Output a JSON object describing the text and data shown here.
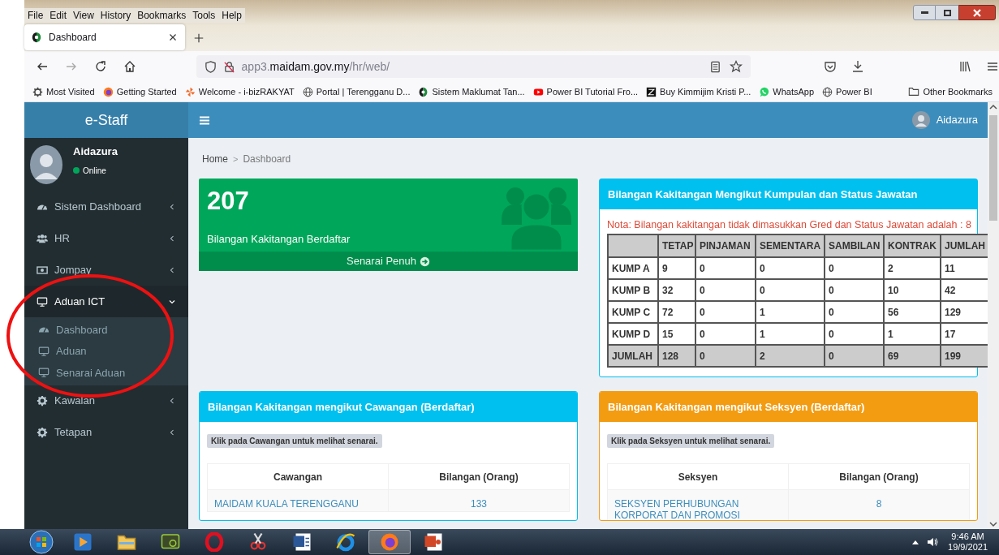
{
  "menu_bar": [
    "File",
    "Edit",
    "View",
    "History",
    "Bookmarks",
    "Tools",
    "Help"
  ],
  "tabs": [
    {
      "title": "Dashboard",
      "selected": true
    }
  ],
  "address_bar": {
    "prefix": "app3.",
    "domain": "maidam.gov.my",
    "path": "/hr/web/"
  },
  "bookmarks": [
    {
      "label": "Most Visited",
      "kind": "gear"
    },
    {
      "label": "Getting Started",
      "kind": "firefox"
    },
    {
      "label": "Welcome - i-bizRAKYAT",
      "kind": "pinwheel"
    },
    {
      "label": "Portal | Terengganu D...",
      "kind": "globe"
    },
    {
      "label": "Sistem Maklumat Tan...",
      "kind": "crest"
    },
    {
      "label": "Power BI Tutorial Fro...",
      "kind": "play"
    },
    {
      "label": "Buy Kimmijim Kristi P...",
      "kind": "square"
    },
    {
      "label": "WhatsApp",
      "kind": "chat"
    },
    {
      "label": "Power BI",
      "kind": "globe"
    }
  ],
  "other_bookmarks": "Other Bookmarks",
  "app": {
    "brand": "e-Staff",
    "top_user": "Aidazura",
    "user": {
      "name": "Aidazura",
      "status": "Online"
    },
    "sidebar": [
      {
        "label": "Sistem Dashboard",
        "kind": "dashboard",
        "expanded": false
      },
      {
        "label": "HR",
        "kind": "users",
        "expanded": false
      },
      {
        "label": "Jompay",
        "kind": "money",
        "expanded": false
      },
      {
        "label": "Aduan ICT",
        "kind": "monitor",
        "expanded": true,
        "children": [
          {
            "label": "Dashboard",
            "kind": "dashboard"
          },
          {
            "label": "Aduan",
            "kind": "monitor"
          },
          {
            "label": "Senarai Aduan",
            "kind": "monitor"
          }
        ]
      },
      {
        "label": "Kawalan",
        "kind": "gear",
        "expanded": false
      },
      {
        "label": "Tetapan",
        "kind": "gear",
        "expanded": false
      }
    ],
    "breadcrumb": {
      "items": [
        "Home",
        "Dashboard"
      ],
      "separator": ">"
    },
    "stat_card": {
      "value": "207",
      "label": "Bilangan Kakitangan Berdaftar",
      "link": "Senarai Penuh"
    },
    "status_panel": {
      "title": "Bilangan Kakitangan Mengikut Kumpulan dan Status Jawatan",
      "note": "Nota: Bilangan kakitangan tidak dimasukkan Gred dan Status Jawatan adalah : 8",
      "columns": [
        "TETAP",
        "PINJAMAN",
        "SEMENTARA",
        "SAMBILAN",
        "KONTRAK",
        "JUMLAH"
      ],
      "rows": [
        {
          "label": "KUMP A",
          "kind": "group",
          "values": [
            "9",
            "0",
            "0",
            "0",
            "2",
            "11"
          ]
        },
        {
          "label": "KUMP B",
          "kind": "group",
          "values": [
            "32",
            "0",
            "0",
            "0",
            "10",
            "42"
          ]
        },
        {
          "label": "KUMP C",
          "kind": "group",
          "values": [
            "72",
            "0",
            "1",
            "0",
            "56",
            "129"
          ]
        },
        {
          "label": "KUMP D",
          "kind": "group",
          "values": [
            "15",
            "0",
            "1",
            "0",
            "1",
            "17"
          ]
        },
        {
          "label": "JUMLAH",
          "kind": "total",
          "values": [
            "128",
            "0",
            "2",
            "0",
            "69",
            "199"
          ]
        }
      ]
    },
    "branch_panel": {
      "title": "Bilangan Kakitangan mengikut Cawangan (Berdaftar)",
      "hint": "Klik pada Cawangan untuk melihat senarai.",
      "columns": [
        "Cawangan",
        "Bilangan (Orang)"
      ],
      "rows": [
        [
          "MAIDAM KUALA TERENGGANU",
          "133"
        ]
      ]
    },
    "section_panel": {
      "title": "Bilangan Kakitangan mengikut Seksyen (Berdaftar)",
      "hint": "Klik pada Seksyen untuk melihat senarai.",
      "columns": [
        "Seksyen",
        "Bilangan (Orang)"
      ],
      "rows": [
        [
          "SEKSYEN PERHUBUNGAN KORPORAT DAN PROMOSI",
          "8"
        ]
      ]
    }
  },
  "annotation": {
    "kind": "ellipse"
  },
  "taskbar": {
    "apps": [
      {
        "kind": "media",
        "selected": false
      },
      {
        "kind": "explorer",
        "selected": false
      },
      {
        "kind": "remote",
        "selected": false
      },
      {
        "kind": "opera",
        "selected": false
      },
      {
        "kind": "snip",
        "selected": false
      },
      {
        "kind": "word",
        "selected": false
      },
      {
        "kind": "ie",
        "selected": false
      },
      {
        "kind": "firefox",
        "selected": true
      },
      {
        "kind": "ppt",
        "selected": false
      }
    ],
    "time": "9:46 AM",
    "date": "19/9/2021"
  }
}
